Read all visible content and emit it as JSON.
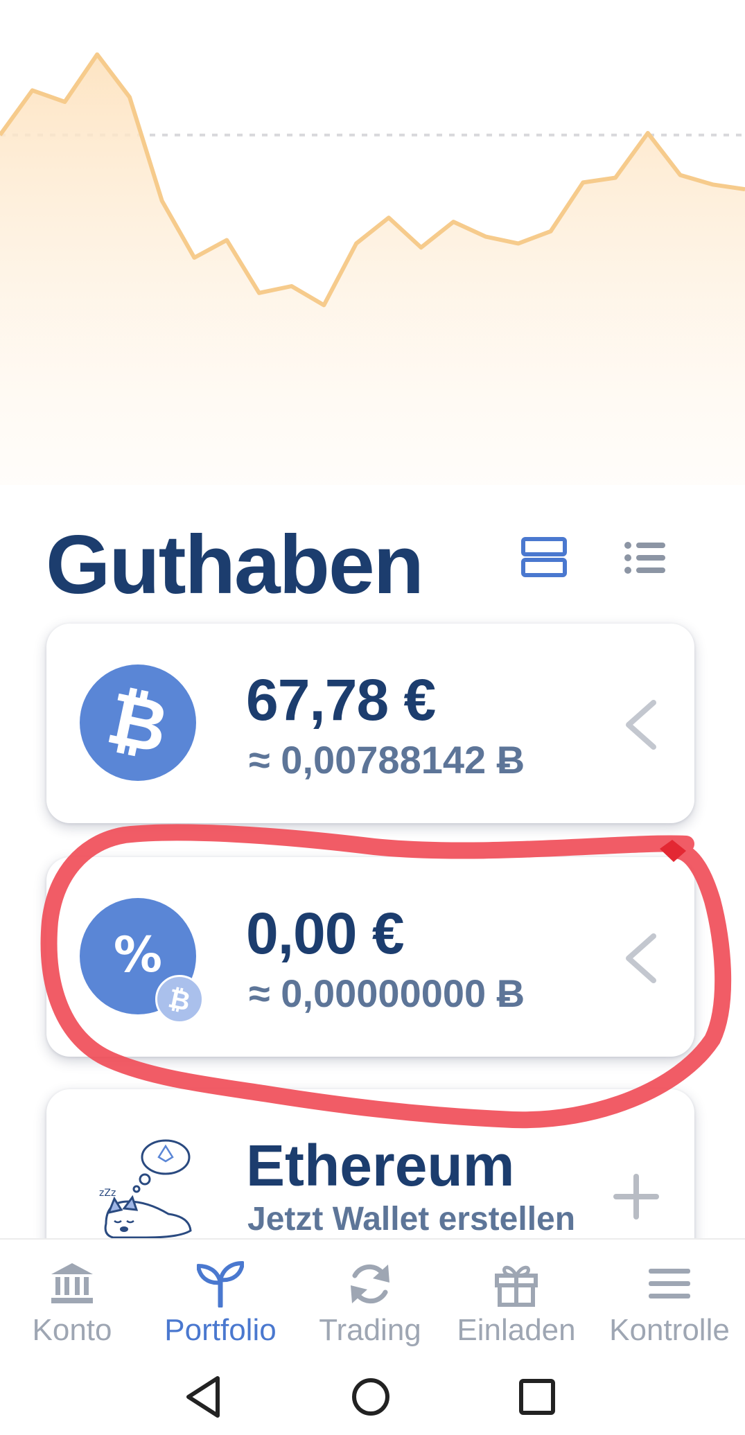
{
  "chart_data": {
    "type": "area",
    "values": [
      81.2,
      87.8,
      86.1,
      93.1,
      86.8,
      71.5,
      63.1,
      65.7,
      57.9,
      58.9,
      56.1,
      65.2,
      69.0,
      64.6,
      68.4,
      66.2,
      65.2,
      67.0,
      74.2,
      74.9,
      81.5,
      75.3,
      73.9,
      73.2
    ],
    "reference_value": 81.2,
    "line_color": "#f6cb8c",
    "fill_color": "#fde9cf"
  },
  "balances": {
    "title": "Guthaben",
    "view_toggle_cards_icon": "cards-view-icon",
    "view_toggle_list_icon": "list-view-icon",
    "items": [
      {
        "icon": "bitcoin-icon",
        "amount_eur": "67,78 €",
        "amount_btc": "≈ 0,00788142 Ƀ",
        "action_icon": "chevron-left-icon"
      },
      {
        "icon": "percent-icon",
        "badge_icon": "bitcoin-icon",
        "amount_eur": "0,00 €",
        "amount_btc": "≈ 0,00000000 Ƀ",
        "action_icon": "chevron-left-icon"
      },
      {
        "icon": "sleeping-dog-illustration",
        "title": "Ethereum",
        "subtitle": "Jetzt Wallet erstellen",
        "action_icon": "plus-icon"
      }
    ]
  },
  "colors": {
    "accent": "#4a78cf",
    "coin": "#5a86d6",
    "heading": "#1c3d6e",
    "highlight": "#ef4a55"
  },
  "bottom_nav": {
    "items": [
      {
        "label": "Konto",
        "icon": "bank-icon",
        "active": false
      },
      {
        "label": "Portfolio",
        "icon": "sprout-icon",
        "active": true
      },
      {
        "label": "Trading",
        "icon": "refresh-icon",
        "active": false
      },
      {
        "label": "Einladen",
        "icon": "gift-icon",
        "active": false
      },
      {
        "label": "Kontrolle",
        "icon": "menu-icon",
        "active": false
      }
    ]
  },
  "system_nav": {
    "icons": [
      "back-icon",
      "home-icon",
      "recents-icon"
    ]
  }
}
